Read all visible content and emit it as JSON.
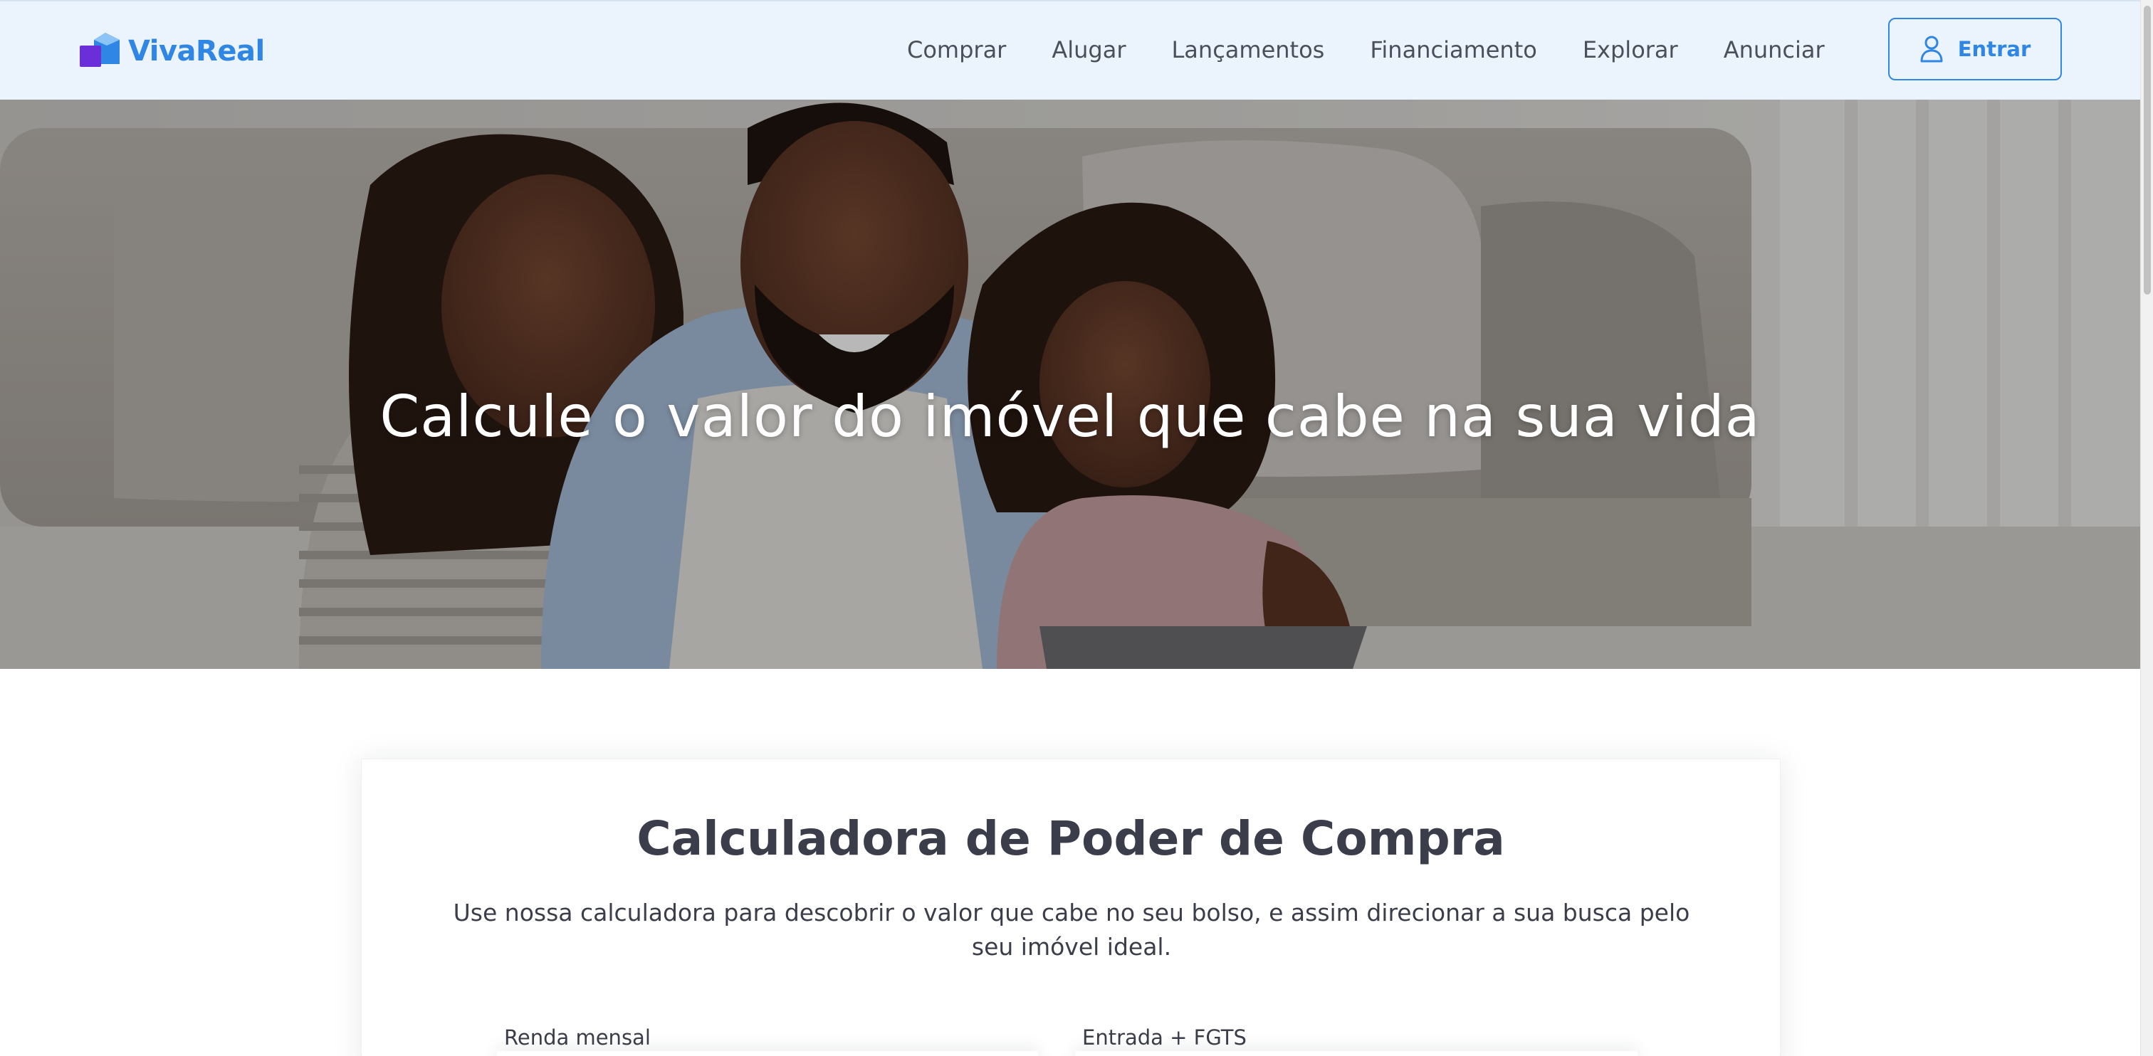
{
  "brand": {
    "name": "VivaReal",
    "primary_color": "#2f86e4",
    "mark_colors": [
      "#6b2fd9",
      "#2f86e4",
      "#8bc4f5"
    ]
  },
  "nav": {
    "items": [
      "Comprar",
      "Alugar",
      "Lançamentos",
      "Financiamento",
      "Explorar",
      "Anunciar"
    ],
    "login_label": "Entrar",
    "login_icon": "user-icon"
  },
  "hero": {
    "title": "Calcule o valor do imóvel que cabe na sua vida",
    "image": "family-on-sofa-photo"
  },
  "calculator": {
    "title": "Calculadora de Poder de Compra",
    "description": "Use nossa calculadora para descobrir o valor que cabe no seu bolso, e assim direcionar a sua busca pelo seu imóvel ideal.",
    "fields": [
      {
        "label": "Renda mensal"
      },
      {
        "label": "Entrada + FGTS"
      }
    ]
  }
}
